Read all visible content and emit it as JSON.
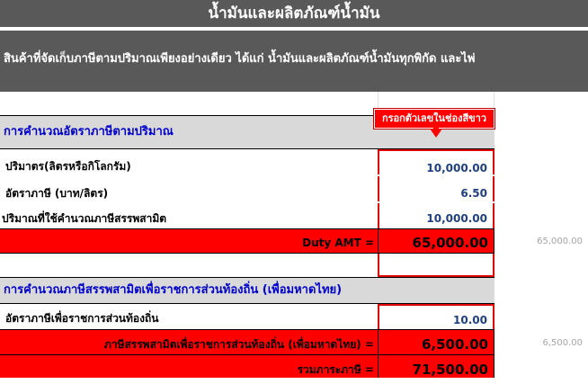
{
  "header": {
    "title": "น้ำมันและผลิตภัณฑ์น้ำมัน",
    "description": "สินค้าที่จัดเก็บภาษีตามปริมาณเพียงอย่างเดียว ได้แก่ น้ำมันและผลิตภัณฑ์น้ำมันทุกพิกัด และไพ่"
  },
  "callout": "กรอกตัวเลขในช่องสีขาว",
  "section1": {
    "title": "การคำนวณอัตราภาษีตามปริมาณ",
    "rows": [
      {
        "label": "ปริมาตร(ลิตรหรือกิโลกรัม)",
        "value": "10,000.00"
      },
      {
        "label": "อัตราภาษี (บาท/ลิตร)",
        "value": "6.50"
      },
      {
        "label": "ปริมาณที่ใช้คำนวณภาษีสรรพสามิต",
        "value": "10,000.00"
      }
    ],
    "duty_label": "Duty AMT =",
    "duty_value": "65,000.00",
    "duty_side": "65,000.00"
  },
  "section2": {
    "title": "การคำนวณภาษีสรรพสามิตเพื่อราชการส่วนท้องถิ่น (เพื่อมหาดไทย)",
    "rate_label": "อัตราภาษีเพื่อราชการส่วนท้องถิ่น",
    "rate_value": "10.00",
    "local_label": "ภาษีสรรพสามิตเพื่อราชการส่วนท้องถิ่น (เพื่อมหาดไทย) =",
    "local_value": "6,500.00",
    "local_side": "6,500.00",
    "total_label": "รวมภาระภาษี =",
    "total_value": "71,500.00"
  }
}
